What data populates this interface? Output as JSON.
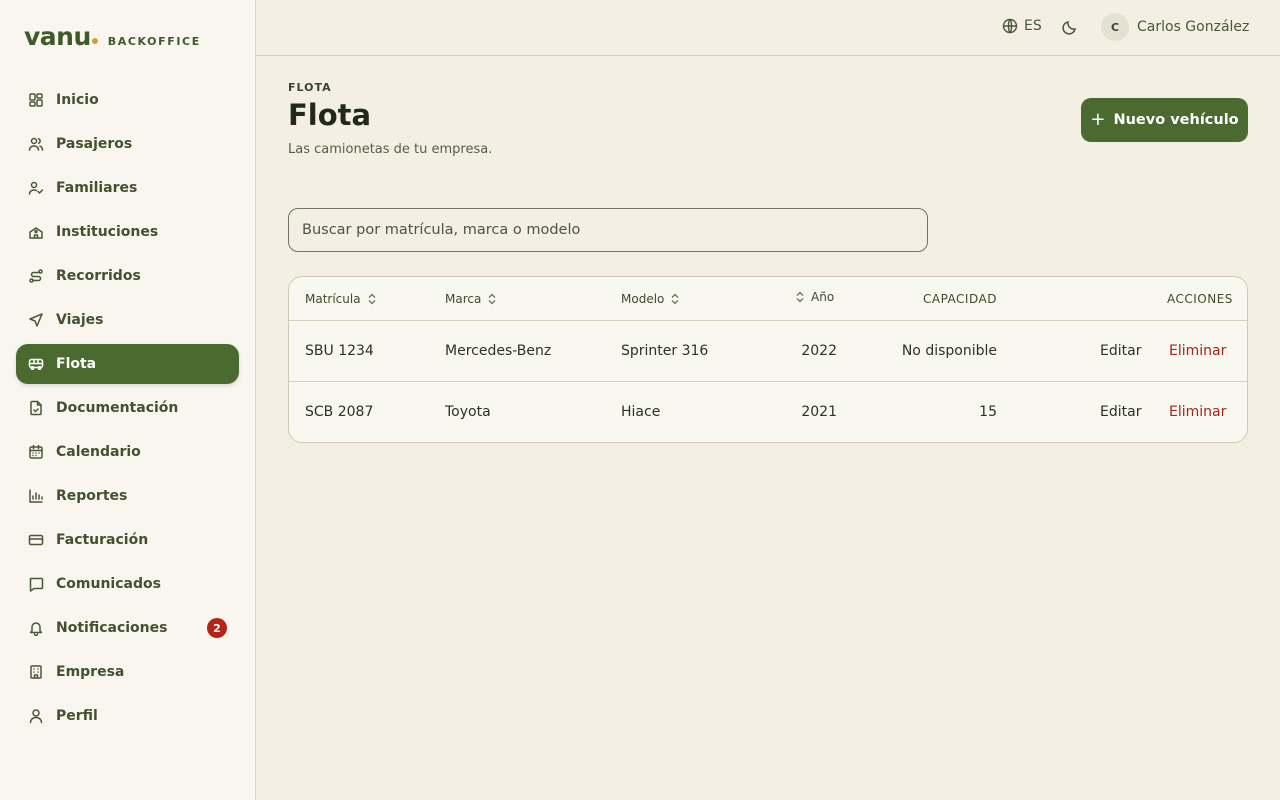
{
  "brand": {
    "logo": "vanu",
    "subtitle": "BACKOFFICE"
  },
  "sidebar": {
    "items": [
      {
        "label": "Inicio",
        "icon": "grid-icon"
      },
      {
        "label": "Pasajeros",
        "icon": "users-icon"
      },
      {
        "label": "Familiares",
        "icon": "user-check-icon"
      },
      {
        "label": "Instituciones",
        "icon": "school-icon"
      },
      {
        "label": "Recorridos",
        "icon": "route-icon"
      },
      {
        "label": "Viajes",
        "icon": "navigation-icon"
      },
      {
        "label": "Flota",
        "icon": "bus-icon",
        "active": true
      },
      {
        "label": "Documentación",
        "icon": "file-check-icon"
      },
      {
        "label": "Calendario",
        "icon": "calendar-icon"
      },
      {
        "label": "Reportes",
        "icon": "bar-chart-icon"
      },
      {
        "label": "Facturación",
        "icon": "credit-card-icon"
      },
      {
        "label": "Comunicados",
        "icon": "message-icon"
      },
      {
        "label": "Notificaciones",
        "icon": "bell-icon",
        "badge": "2"
      },
      {
        "label": "Empresa",
        "icon": "building-icon"
      },
      {
        "label": "Perfil",
        "icon": "user-icon"
      }
    ]
  },
  "topbar": {
    "language": "ES",
    "user": {
      "initial": "C",
      "name": "Carlos González"
    }
  },
  "page": {
    "eyebrow": "FLOTA",
    "title": "Flota",
    "subtitle": "Las camionetas de tu empresa.",
    "new_button": "Nuevo vehículo",
    "plus": "+"
  },
  "search": {
    "placeholder": "Buscar por matrícula, marca o modelo"
  },
  "table": {
    "headers": {
      "plate": "Matrícula",
      "brand": "Marca",
      "model": "Modelo",
      "year": "Año",
      "capacity": "CAPACIDAD",
      "actions": "ACCIONES"
    },
    "rows": [
      {
        "plate": "SBU 1234",
        "brand": "Mercedes-Benz",
        "model": "Sprinter 316",
        "year": "2022",
        "capacity": "No disponible",
        "edit": "Editar",
        "delete": "Eliminar"
      },
      {
        "plate": "SCB 2087",
        "brand": "Toyota",
        "model": "Hiace",
        "year": "2021",
        "capacity": "15",
        "edit": "Editar",
        "delete": "Eliminar"
      }
    ]
  },
  "colors": {
    "accent": "#4a6a30",
    "background": "#f3efe3",
    "sidebar": "#f8f6ee",
    "danger": "#a3261a",
    "badge": "#b42318"
  }
}
